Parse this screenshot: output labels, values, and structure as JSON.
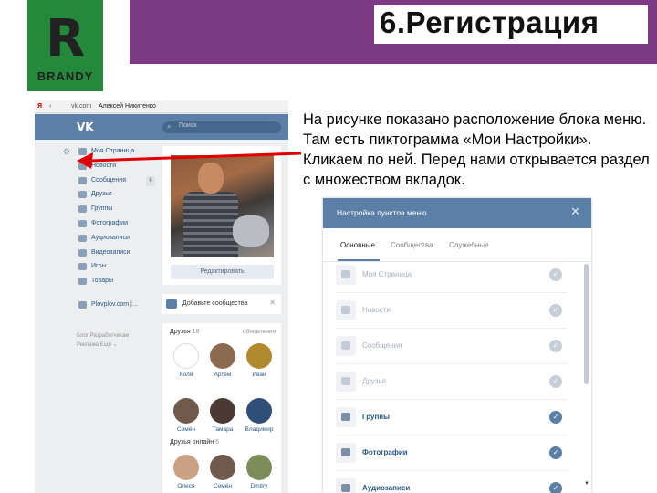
{
  "slide": {
    "title": "6.Регистрация",
    "caption": "На рисунке показано расположение блока меню. Там  есть пиктограмма «Мои Настройки». Кликаем по ней. Перед нами открывается раздел с множеством вкладок."
  },
  "logo": {
    "letter": "R",
    "brand": "BRANDY",
    "color": "#25893b"
  },
  "colors": {
    "header_band": "#7d3a84",
    "vk_blue": "#5b7fa6",
    "arrow": "#e00000"
  },
  "browser": {
    "address_icon": "Я",
    "url": "vk.com",
    "user_name": "Алексей Никитенко"
  },
  "vk": {
    "logo": "VK",
    "search_placeholder": "Поиск",
    "menu": [
      {
        "label": "Моя Страница",
        "icon": "home-icon"
      },
      {
        "label": "Новости",
        "icon": "news-icon"
      },
      {
        "label": "Сообщения",
        "icon": "messages-icon",
        "badge": "6"
      },
      {
        "label": "Друзья",
        "icon": "friends-icon"
      },
      {
        "label": "Группы",
        "icon": "groups-icon"
      },
      {
        "label": "Фотографии",
        "icon": "photos-icon"
      },
      {
        "label": "Аудиозаписи",
        "icon": "audio-icon"
      },
      {
        "label": "Видеозаписи",
        "icon": "video-icon"
      },
      {
        "label": "Игры",
        "icon": "games-icon"
      },
      {
        "label": "Товары",
        "icon": "goods-icon"
      }
    ],
    "app_item": "Plovplov.com |...",
    "footer_line1": "Блог   Разработчикам",
    "footer_line2": "Реклама   Ещё ⌄",
    "edit_button": "Редактировать",
    "add_communities": "Добавьте сообщества",
    "friends_label": "Друзья",
    "friends_count": "18",
    "friends_link": "обновления",
    "friends": [
      {
        "name": "Коля",
        "color": "#ffffff"
      },
      {
        "name": "Артем",
        "color": "#8b6a4f"
      },
      {
        "name": "Иван",
        "color": "#b28a2e"
      },
      {
        "name": "Семён",
        "color": "#6f5a4c"
      },
      {
        "name": "Тамара",
        "color": "#4b3a33"
      },
      {
        "name": "Владимир",
        "color": "#2f4f78"
      }
    ],
    "online_label": "Друзья онлайн",
    "online_count": "6",
    "online_friends": [
      {
        "name": "Олеся",
        "color": "#caa184"
      },
      {
        "name": "Семён",
        "color": "#6f5a4c"
      },
      {
        "name": "Dmitry",
        "color": "#7c8d5a"
      }
    ]
  },
  "dialog": {
    "title": "Настройка пунктов меню",
    "close": "✕",
    "tabs": [
      "Основные",
      "Сообщества",
      "Служебные"
    ],
    "active_tab": 0,
    "items": [
      {
        "label": "Моя Страница",
        "enabled": false
      },
      {
        "label": "Новости",
        "enabled": false
      },
      {
        "label": "Сообщения",
        "enabled": false
      },
      {
        "label": "Друзья",
        "enabled": false
      },
      {
        "label": "Группы",
        "enabled": true
      },
      {
        "label": "Фотографии",
        "enabled": true
      },
      {
        "label": "Аудиозаписи",
        "enabled": true
      }
    ]
  }
}
